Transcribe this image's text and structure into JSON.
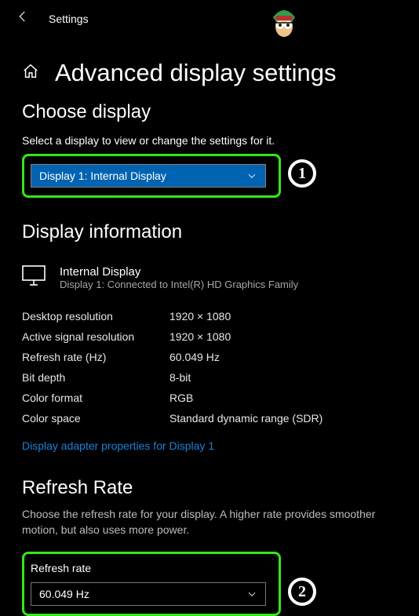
{
  "titlebar": {
    "title": "Settings"
  },
  "page": {
    "title": "Advanced display settings"
  },
  "choose_display": {
    "heading": "Choose display",
    "help": "Select a display to view or change the settings for it.",
    "selected": "Display 1: Internal Display",
    "annotation": "1"
  },
  "display_info": {
    "heading": "Display information",
    "name": "Internal Display",
    "sub": "Display 1: Connected to Intel(R) HD Graphics Family",
    "rows": [
      {
        "label": "Desktop resolution",
        "value": "1920 × 1080"
      },
      {
        "label": "Active signal resolution",
        "value": "1920 × 1080"
      },
      {
        "label": "Refresh rate (Hz)",
        "value": "60.049 Hz"
      },
      {
        "label": "Bit depth",
        "value": "8-bit"
      },
      {
        "label": "Color format",
        "value": "RGB"
      },
      {
        "label": "Color space",
        "value": "Standard dynamic range (SDR)"
      }
    ],
    "adapter_link": "Display adapter properties for Display 1"
  },
  "refresh": {
    "heading": "Refresh Rate",
    "help": "Choose the refresh rate for your display. A higher rate provides smoother motion, but also uses more power.",
    "label": "Refresh rate",
    "selected": "60.049 Hz",
    "annotation": "2"
  }
}
